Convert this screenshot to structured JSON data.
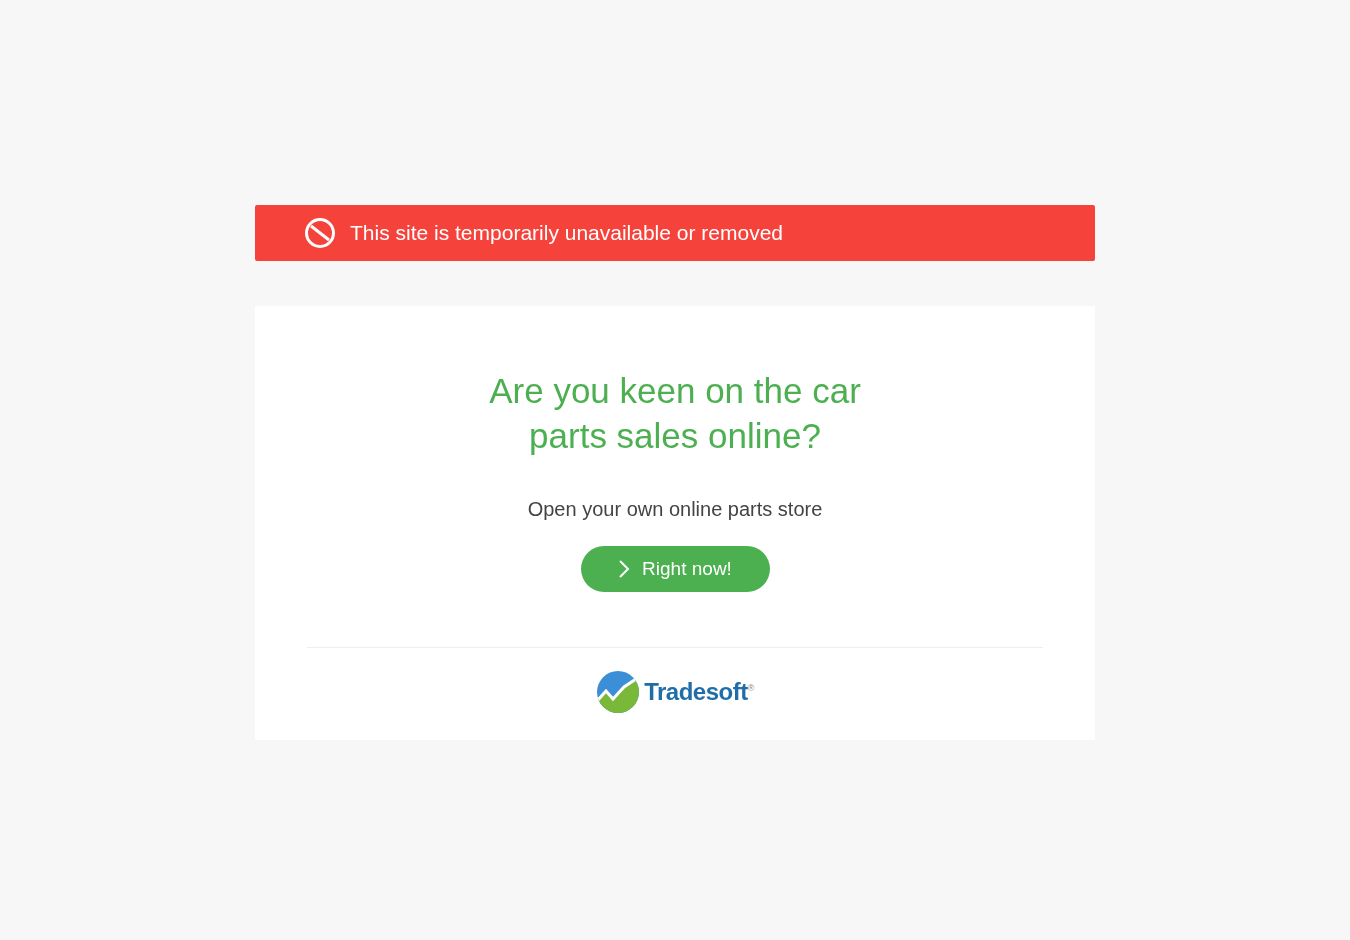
{
  "alert": {
    "text": "This site is temporarily unavailable or removed"
  },
  "promo": {
    "heading": "Are you keen on the car parts sales online?",
    "subtitle": "Open your own online parts store",
    "button": "Right now!"
  },
  "footer": {
    "brand": "Tradesoft$^{®}$"
  }
}
